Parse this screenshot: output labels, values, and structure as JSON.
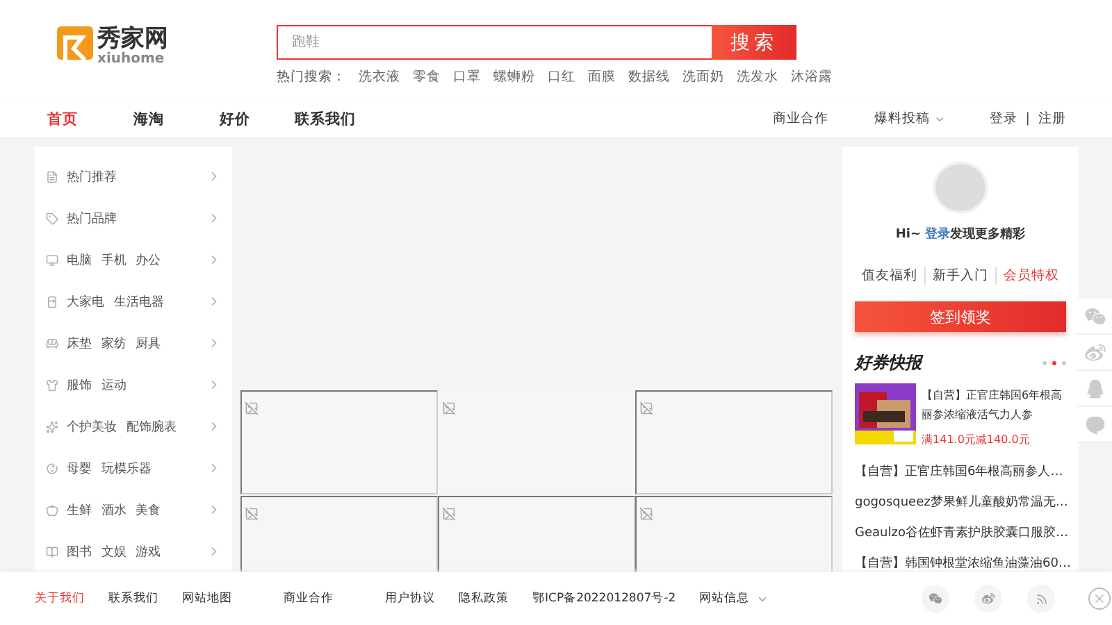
{
  "logo": {
    "name": "秀家网",
    "subtitle": "xiuhome"
  },
  "search": {
    "placeholder": "跑鞋",
    "button": "搜索",
    "hot_label": "热门搜索：",
    "hot_terms": [
      "洗衣液",
      "零食",
      "口罩",
      "螺蛳粉",
      "口红",
      "面膜",
      "数据线",
      "洗面奶",
      "洗发水",
      "沐浴露"
    ]
  },
  "nav": {
    "items": [
      {
        "label": "首页",
        "selected": true
      },
      {
        "label": "海淘",
        "selected": false
      },
      {
        "label": "好价",
        "selected": false
      },
      {
        "label": "联系我们",
        "selected": false
      }
    ],
    "right": {
      "business": "商业合作",
      "submit": "爆料投稿",
      "login": "登录",
      "separator": "|",
      "register": "注册"
    }
  },
  "sidebar": {
    "items": [
      "热门推荐",
      "热门品牌",
      "电脑 手机 办公",
      "大家电 生活电器",
      "床垫 家纺 厨具",
      "服饰 运动",
      "个护美妆 配饰腕表",
      "母婴 玩模乐器",
      "生鲜 酒水 美食",
      "图书 文娱 游戏"
    ]
  },
  "tiles": [
    {
      "bordered": true
    },
    {
      "bordered": false
    },
    {
      "bordered": true
    },
    {
      "bordered": true
    },
    {
      "bordered": true
    },
    {
      "bordered": true
    }
  ],
  "user_panel": {
    "greeting": "Hi~",
    "login_link": "登录",
    "greeting_rest": "发现更多精彩",
    "links": [
      {
        "label": "值友福利",
        "highlight": false
      },
      {
        "label": "新手入门",
        "highlight": false
      },
      {
        "label": "会员特权",
        "highlight": true
      }
    ],
    "checkin_button": "签到领奖",
    "news_title": "好券快报",
    "dots": [
      {
        "selected": false
      },
      {
        "selected": true
      },
      {
        "selected": false
      }
    ],
    "featured": {
      "title": "【自营】正官庄韩国6年根高丽参浓缩液活气力人参",
      "coupon": "满141.0元减140.0元"
    },
    "news": [
      "【自营】正官庄韩国6年根高丽参人…",
      "gogosqueez梦果鲜儿童酸奶常温无…",
      "Geaulzo谷佐虾青素护肤胶囊口服胶…",
      "【自营】韩国钟根堂浓缩鱼油藻油60…"
    ]
  },
  "footer": {
    "links": [
      {
        "label": "关于我们",
        "selected": true
      },
      {
        "label": "联系我们",
        "selected": false
      },
      {
        "label": "网站地图",
        "selected": false
      },
      {
        "label": "商业合作",
        "selected": false
      },
      {
        "label": "用户协议",
        "selected": false
      },
      {
        "label": "隐私政策",
        "selected": false
      },
      {
        "label": "鄂ICP备2022012807号-2",
        "selected": false
      },
      {
        "label": "网站信息",
        "selected": false
      }
    ]
  }
}
